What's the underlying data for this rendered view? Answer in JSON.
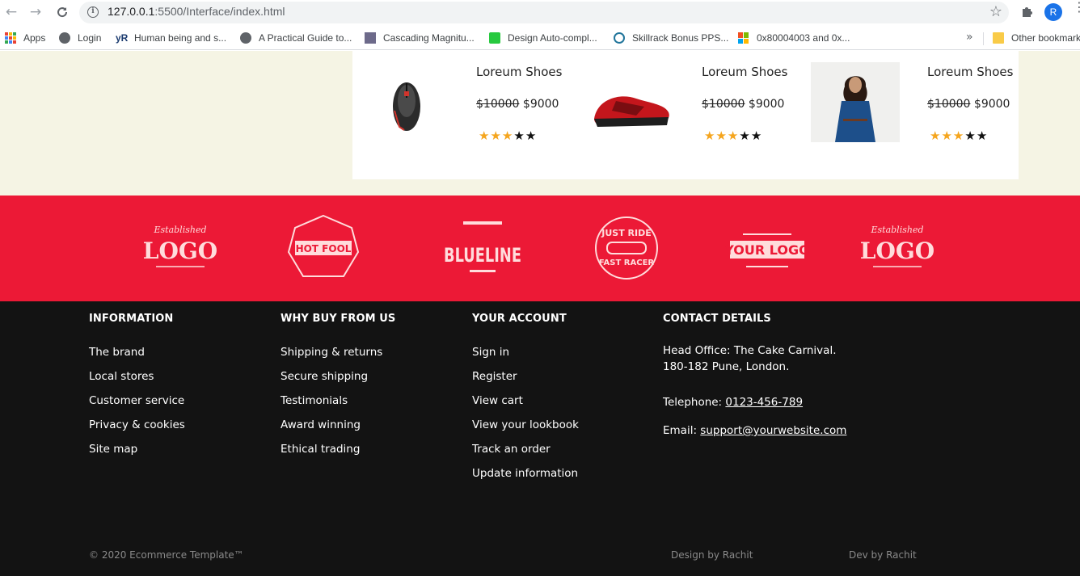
{
  "browser": {
    "url_host": "127.0.0.1",
    "url_path": ":5500/Interface/index.html",
    "profile_initial": "R",
    "bookmarks": [
      {
        "label": "Apps",
        "icon": "apps-grid-icon"
      },
      {
        "label": "Login",
        "icon": "globe-icon"
      },
      {
        "label": "Human being and s...",
        "icon": "yr-icon"
      },
      {
        "label": "A Practical Guide to...",
        "icon": "globe-icon"
      },
      {
        "label": "Cascading Magnitu...",
        "icon": "site-icon"
      },
      {
        "label": "Design Auto-compl...",
        "icon": "alarm-icon"
      },
      {
        "label": "Skillrack Bonus PPS...",
        "icon": "wordpress-icon"
      },
      {
        "label": "0x80004003 and 0x...",
        "icon": "windows-icon"
      }
    ],
    "more_label": "»",
    "other_bookmarks": "Other bookmarks"
  },
  "products": [
    {
      "name": "Loreum Shoes",
      "old_price": "$10000",
      "price": "$9000",
      "rating": 3,
      "image": "mouse"
    },
    {
      "name": "Loreum Shoes",
      "old_price": "$10000",
      "price": "$9000",
      "rating": 3,
      "image": "sneaker"
    },
    {
      "name": "Loreum Shoes",
      "old_price": "$10000",
      "price": "$9000",
      "rating": 3,
      "image": "dress"
    }
  ],
  "brands": [
    {
      "text": "LOGO",
      "sub": "Established",
      "shape": "arch"
    },
    {
      "text": "HOT FOOL",
      "sub": "",
      "shape": "badge"
    },
    {
      "text": "BLUELINE",
      "sub": "",
      "shape": "tall"
    },
    {
      "text": "FAST RACER",
      "sub": "JUST RIDE",
      "shape": "circle"
    },
    {
      "text": "YOUR LOGO",
      "sub": "",
      "shape": "banner"
    },
    {
      "text": "LOGO",
      "sub": "Established",
      "shape": "arch"
    }
  ],
  "footer": {
    "information": {
      "title": "INFORMATION",
      "links": [
        "The brand",
        "Local stores",
        "Customer service",
        "Privacy & cookies",
        "Site map"
      ]
    },
    "why": {
      "title": "WHY BUY FROM US",
      "links": [
        "Shipping & returns",
        "Secure shipping",
        "Testimonials",
        "Award winning",
        "Ethical trading"
      ]
    },
    "account": {
      "title": "YOUR ACCOUNT",
      "links": [
        "Sign in",
        "Register",
        "View cart",
        "View your lookbook",
        "Track an order",
        "Update information"
      ]
    },
    "contact": {
      "title": "CONTACT DETAILS",
      "address1": "Head Office: The Cake Carnival.",
      "address2": "180-182 Pune, London.",
      "phone_label": "Telephone: ",
      "phone": "0123-456-789",
      "email_label": "Email: ",
      "email": "support@yourwebsite.com"
    },
    "copyright": "© 2020 Ecommerce Template™",
    "design_credit": "Design by Rachit",
    "dev_credit": "Dev by Rachit"
  },
  "colors": {
    "brand_red": "#ec1936",
    "footer_bg": "#131313",
    "cream_bg": "#f5f4e4",
    "star_on": "#f5a51e"
  }
}
